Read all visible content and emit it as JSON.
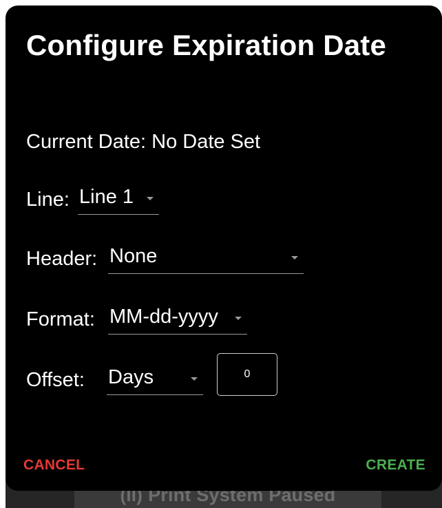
{
  "dialog": {
    "title": "Configure Expiration Date",
    "current_date_label": "Current Date: No Date Set",
    "line": {
      "label": "Line:",
      "value": "Line 1"
    },
    "header": {
      "label": "Header:",
      "value": "None"
    },
    "format": {
      "label": "Format:",
      "value": "MM-dd-yyyy"
    },
    "offset": {
      "label": "Offset:",
      "unit": "Days",
      "amount": "0"
    },
    "buttons": {
      "cancel": "CANCEL",
      "create": "CREATE"
    }
  },
  "background": {
    "status_glyph": "(II)",
    "status_text": "Print System Paused"
  },
  "colors": {
    "dialog_bg": "#000000",
    "cancel": "#e53935",
    "create": "#4caf50",
    "underline": "#9a9a9a"
  }
}
